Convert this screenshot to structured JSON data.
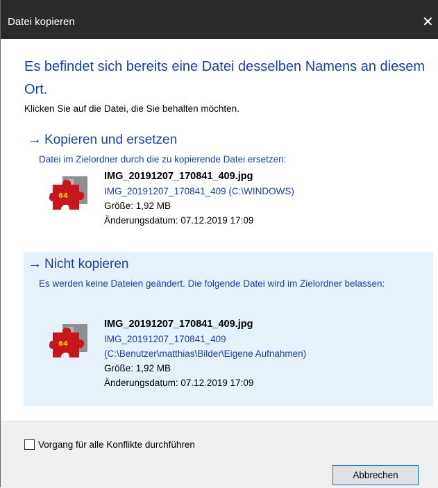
{
  "window": {
    "title": "Datei kopieren",
    "close_label": "✕"
  },
  "heading": "Es befindet sich bereits eine Datei desselben Namens an diesem Ort.",
  "instruction": "Klicken Sie auf die Datei, die Sie behalten möchten.",
  "options": {
    "replace": {
      "arrow": "→",
      "title": "Kopieren und ersetzen",
      "description": "Datei im Zielordner durch die zu kopierende Datei ersetzen:",
      "file": {
        "name": "IMG_20191207_170841_409.jpg",
        "location": "IMG_20191207_170841_409 (C:\\WINDOWS)",
        "size": "Größe: 1,92 MB",
        "modified": "Änderungsdatum: 07.12.2019 17:09"
      }
    },
    "skip": {
      "arrow": "→",
      "title": "Nicht kopieren",
      "description": "Es werden keine Dateien geändert. Die folgende Datei wird im Zielordner belassen:",
      "file": {
        "name": "IMG_20191207_170841_409.jpg",
        "location_line1": "IMG_20191207_170841_409",
        "location_line2": "(C:\\Benutzer\\matthias\\Bilder\\Eigene Aufnahmen)",
        "size": "Größe: 1,92 MB",
        "modified": "Änderungsdatum: 07.12.2019 17:09"
      }
    }
  },
  "footer": {
    "apply_all_label": "Vorgang für alle Konflikte durchführen",
    "apply_all_checked": false,
    "cancel_label": "Abbrechen"
  },
  "thumbnail": {
    "badge": "64",
    "colors": {
      "puzzle": "#c8161d",
      "background": "#8f8f8f",
      "badge": "#f0d000"
    }
  }
}
